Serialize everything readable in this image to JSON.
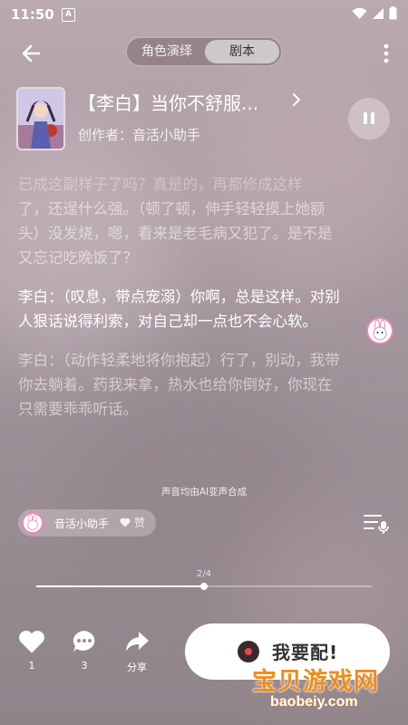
{
  "status_bar": {
    "time": "11:50",
    "badge": "A"
  },
  "header": {
    "tabs": [
      {
        "label": "角色演绎",
        "active": false
      },
      {
        "label": "剧本",
        "active": true
      }
    ]
  },
  "script_card": {
    "title": "【李白】当你不舒服...",
    "author": "创作者：音活小助手",
    "playing": true
  },
  "script": {
    "para1": "已成这副样子了吗？真是的，再都修成这样了，还是什么强。（顿了顿，伸手轻轻摸上她额头）没发烧，嗯，看来是老毛病又犯了。是不是又忘记吃晚饭了？",
    "para1_faded_top": "已成这副样子了吗？真是的，再都修成这样",
    "para1_rest": "了，还逞什么强。（顿了顿，伸手轻轻摸上她额头）没发烧，嗯，看来是老毛病又犯了。是不是又忘记吃晚饭了？",
    "para2": "李白：（叹息，带点宠溺）你啊，总是这样。对别人狠话说得利索，对自己却一点也不会心软。",
    "para3": "李白：（动作轻柔地将你抱起）行了，别动，我带你去躺着。药我来拿，热水也给你倒好，你现在只需要乖乖听话。"
  },
  "ai_note": "声音均由AI变声合成",
  "creator": {
    "name": "音活小助手",
    "like_label": "赞"
  },
  "progress": {
    "label": "2/4",
    "fraction": 0.5
  },
  "actions": {
    "like_count": "1",
    "comment_count": "3",
    "share_label": "分享"
  },
  "cta": {
    "label": "我要配!"
  },
  "watermark": {
    "main": "宝贝游戏网",
    "sub": "baobeiy.com"
  },
  "colors": {
    "accent_pink": "#e98ab3",
    "watermark_orange": "#f08c1a"
  }
}
